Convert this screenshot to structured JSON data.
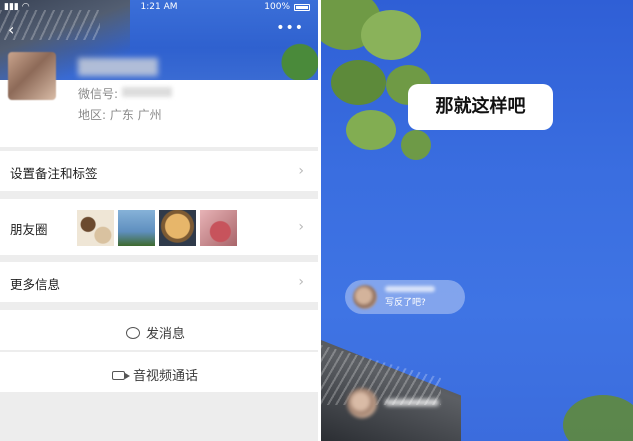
{
  "left_screen": {
    "status_bar": {
      "time": "1:21 AM",
      "battery": "100%"
    },
    "profile": {
      "wechat_id_label": "微信号:",
      "region": "地区: 广东 广州"
    },
    "rows": {
      "remark_tags": "设置备注和标签",
      "moments": "朋友圈",
      "more_info": "更多信息"
    },
    "actions": {
      "send_message": "发消息",
      "av_call": "音视频通话"
    }
  },
  "right_screen": {
    "caption": "那就这样吧",
    "comment": "写反了吧?"
  }
}
